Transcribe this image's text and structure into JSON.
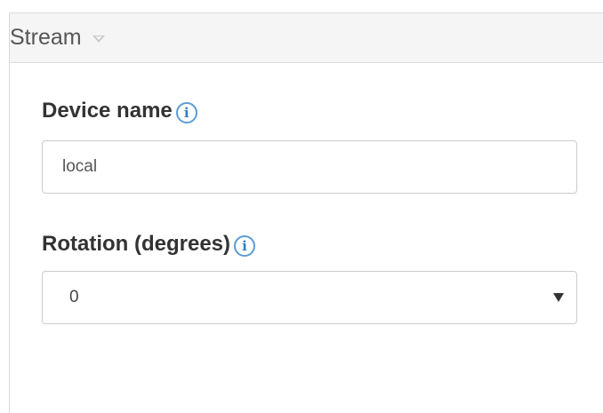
{
  "panel": {
    "title": "Stream",
    "caret_icon": "caret-down-icon"
  },
  "fields": {
    "device_name": {
      "label": "Device name",
      "info_icon": "info-icon",
      "info_glyph": "i",
      "value": "local"
    },
    "rotation": {
      "label": "Rotation (degrees)",
      "info_icon": "info-icon",
      "info_glyph": "i",
      "selected": "0",
      "arrow_icon": "dropdown-arrow-icon"
    }
  },
  "colors": {
    "header_bg": "#f5f5f5",
    "info_icon": "#2f7ec6",
    "border": "#cccccc"
  }
}
